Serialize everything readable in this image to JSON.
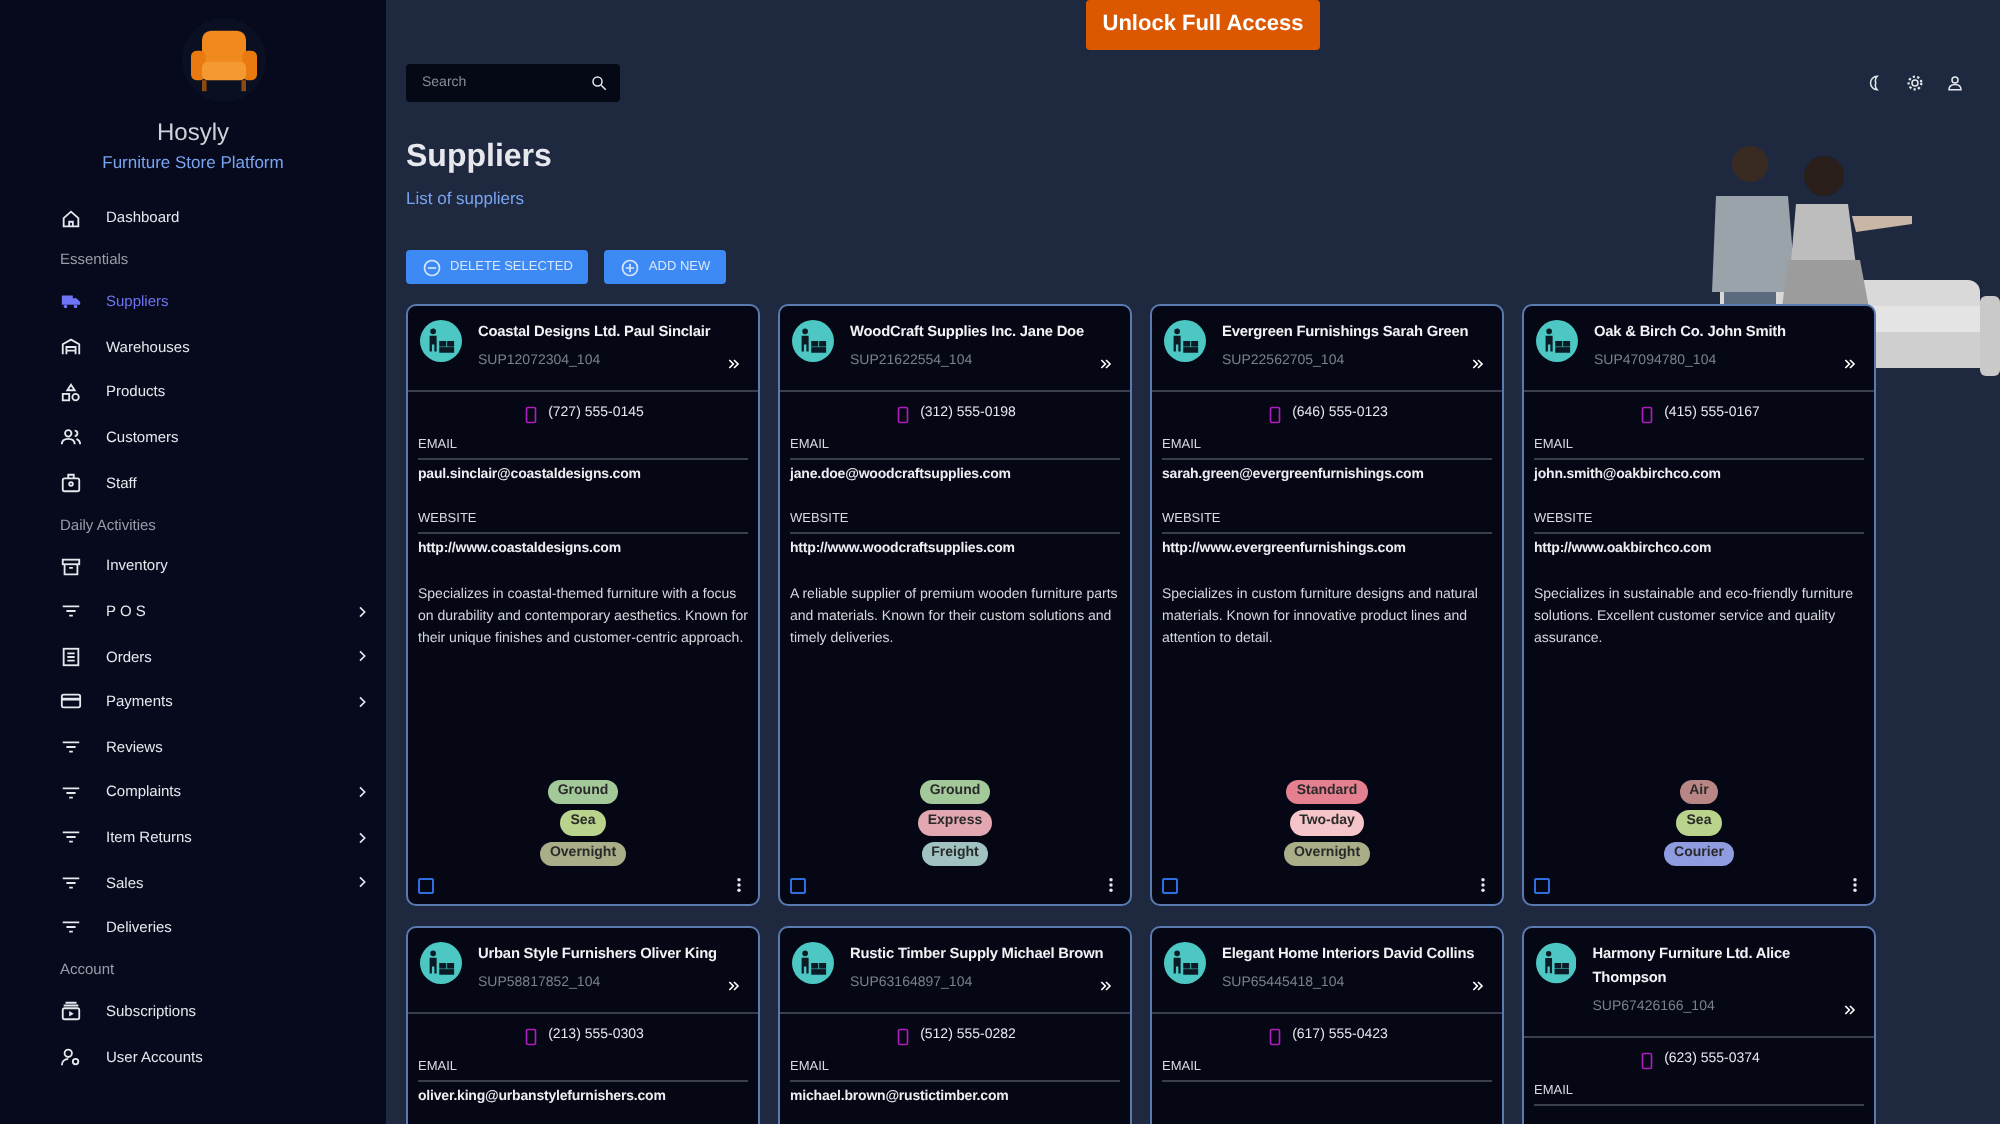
{
  "brand": {
    "name": "Hosyly",
    "tagline": "Furniture Store Platform"
  },
  "sidebar": {
    "groups": [
      {
        "items": [
          {
            "label": "Dashboard",
            "selected": false,
            "has_submenu": false
          }
        ]
      },
      {
        "heading": "Essentials",
        "items": [
          {
            "label": "Suppliers",
            "selected": true,
            "has_submenu": false
          },
          {
            "label": "Warehouses",
            "selected": false,
            "has_submenu": false
          },
          {
            "label": "Products",
            "selected": false,
            "has_submenu": false
          },
          {
            "label": "Customers",
            "selected": false,
            "has_submenu": false
          },
          {
            "label": "Staff",
            "selected": false,
            "has_submenu": false
          }
        ]
      },
      {
        "heading": "Daily Activities",
        "items": [
          {
            "label": "Inventory",
            "selected": false,
            "has_submenu": false
          },
          {
            "label": "P O S",
            "selected": false,
            "has_submenu": true
          },
          {
            "label": "Orders",
            "selected": false,
            "has_submenu": true
          },
          {
            "label": "Payments",
            "selected": false,
            "has_submenu": true
          },
          {
            "label": "Reviews",
            "selected": false,
            "has_submenu": false
          },
          {
            "label": "Complaints",
            "selected": false,
            "has_submenu": true
          },
          {
            "label": "Item Returns",
            "selected": false,
            "has_submenu": true
          },
          {
            "label": "Sales",
            "selected": false,
            "has_submenu": true
          },
          {
            "label": "Deliveries",
            "selected": false,
            "has_submenu": false
          }
        ]
      },
      {
        "heading": "Account",
        "items": [
          {
            "label": "Subscriptions",
            "selected": false,
            "has_submenu": false
          },
          {
            "label": "User Accounts",
            "selected": false,
            "has_submenu": false
          }
        ]
      }
    ]
  },
  "unlock_button": "Unlock Full Access",
  "search": {
    "placeholder": "Search"
  },
  "page": {
    "title": "Suppliers",
    "subtitle": "List of suppliers"
  },
  "actions": [
    "DELETE SELECTED",
    "ADD NEW"
  ],
  "suppliers": [
    {
      "name": "Coastal Designs Ltd. Paul Sinclair",
      "id": "SUP12072304_104",
      "phone": "(727) 555-0145",
      "email_label": "EMAIL",
      "email": "paul.sinclair@coastaldesigns.com",
      "website_label": "WEBSITE",
      "website": "http://www.coastaldesigns.com",
      "description": "Specializes in coastal-themed furniture with a focus on durability and contemporary aesthetics. Known for their unique finishes and customer-centric approach.",
      "tags": [
        {
          "label": "Ground",
          "color": "#a3c99a"
        },
        {
          "label": "Sea",
          "color": "#b9d38c"
        },
        {
          "label": "Overnight",
          "color": "#a9ae88"
        }
      ],
      "checked": false
    },
    {
      "name": "WoodCraft Supplies Inc. Jane Doe",
      "id": "SUP21622554_104",
      "phone": "(312) 555-0198",
      "email_label": "EMAIL",
      "email": "jane.doe@woodcraftsupplies.com",
      "website_label": "WEBSITE",
      "website": "http://www.woodcraftsupplies.com",
      "description": "A reliable supplier of premium wooden furniture parts and materials. Known for their custom solutions and timely deliveries.",
      "tags": [
        {
          "label": "Ground",
          "color": "#a3c99a"
        },
        {
          "label": "Express",
          "color": "#e3a7b2"
        },
        {
          "label": "Freight",
          "color": "#a0c3c2"
        }
      ],
      "checked": false
    },
    {
      "name": "Evergreen Furnishings Sarah Green",
      "id": "SUP22562705_104",
      "phone": "(646) 555-0123",
      "email_label": "EMAIL",
      "email": "sarah.green@evergreenfurnishings.com",
      "website_label": "WEBSITE",
      "website": "http://www.evergreenfurnishings.com",
      "description": "Specializes in custom furniture designs and natural materials. Known for innovative product lines and attention to detail.",
      "tags": [
        {
          "label": "Standard",
          "color": "#e4808f"
        },
        {
          "label": "Two-day",
          "color": "#f6c5c9"
        },
        {
          "label": "Overnight",
          "color": "#a9ae88"
        }
      ],
      "checked": false
    },
    {
      "name": "Oak & Birch Co. John Smith",
      "id": "SUP47094780_104",
      "phone": "(415) 555-0167",
      "email_label": "EMAIL",
      "email": "john.smith@oakbirchco.com",
      "website_label": "WEBSITE",
      "website": "http://www.oakbirchco.com",
      "description": "Specializes in sustainable and eco-friendly furniture solutions. Excellent customer service and quality assurance.",
      "tags": [
        {
          "label": "Air",
          "color": "#b98686"
        },
        {
          "label": "Sea",
          "color": "#b9d38c"
        },
        {
          "label": "Courier",
          "color": "#8f9ce0"
        }
      ],
      "checked": false
    },
    {
      "name": "Urban Style Furnishers Oliver King",
      "id": "SUP58817852_104",
      "phone": "(213) 555-0303",
      "email_label": "EMAIL",
      "email": "oliver.king@urbanstylefurnishers.com"
    },
    {
      "name": "Rustic Timber Supply Michael Brown",
      "id": "SUP63164897_104",
      "phone": "(512) 555-0282",
      "email_label": "EMAIL",
      "email": "michael.brown@rustictimber.com"
    },
    {
      "name": "Elegant Home Interiors David Collins",
      "id": "SUP65445418_104",
      "phone": "(617) 555-0423",
      "email_label": "EMAIL"
    },
    {
      "name": "Harmony Furniture Ltd. Alice Thompson",
      "id": "SUP67426166_104",
      "phone": "(623) 555-0374",
      "email_label": "EMAIL"
    }
  ]
}
